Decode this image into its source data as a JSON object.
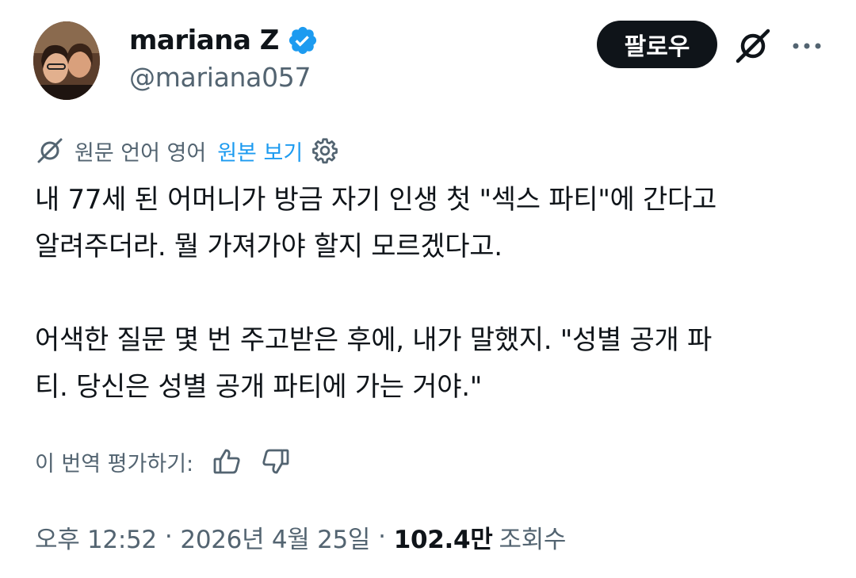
{
  "user": {
    "display_name": "mariana Z",
    "handle": "@mariana057",
    "verified_icon": "verified-badge-icon",
    "avatar": "profile-photo"
  },
  "header": {
    "follow_label": "팔로우",
    "grok_icon": "grok-icon",
    "more_icon": "more-dots-icon"
  },
  "translation": {
    "icon": "globe-translate-icon",
    "source_language_text": "원문 언어 영어",
    "show_original_label": "원본 보기",
    "settings_icon": "gear-icon"
  },
  "tweet": {
    "paragraph_1": "내 77세 된 어머니가 방금 자기 인생 첫 \"섹스 파티\"에 간다고\n알려주더라. 뭘 가져가야 할지 모르겠다고.",
    "paragraph_2": "어색한 질문 몇 번 주고받은 후에, 내가 말했지. \"성별 공개 파\n티. 당신은 성별 공개 파티에 가는 거야.\""
  },
  "rating": {
    "label": "이 번역 평가하기:",
    "thumbs_up_icon": "thumbs-up-icon",
    "thumbs_down_icon": "thumbs-down-icon"
  },
  "meta": {
    "time": "오후 12:52",
    "separator": "·",
    "date": "2026년 4월 25일",
    "views_count": "102.4만",
    "views_label": "조회수"
  },
  "colors": {
    "text_primary": "#0f1419",
    "text_secondary": "#536471",
    "accent_blue": "#1d9bf0",
    "button_dark": "#0f1419"
  }
}
